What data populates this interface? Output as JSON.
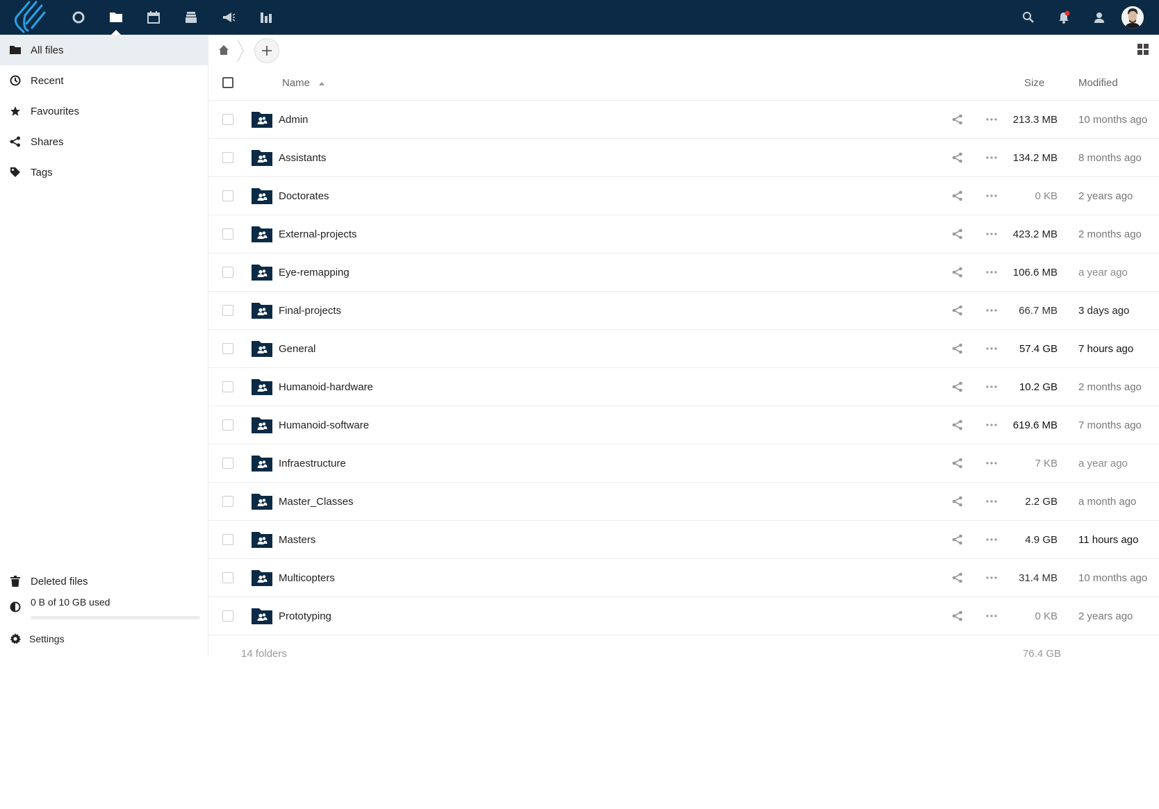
{
  "header": {
    "apps": [
      {
        "name": "dashboard",
        "icon": "circle-icon"
      },
      {
        "name": "files",
        "icon": "folder-icon",
        "active": true
      },
      {
        "name": "calendar",
        "icon": "calendar-icon"
      },
      {
        "name": "deck",
        "icon": "stack-icon"
      },
      {
        "name": "announcements",
        "icon": "megaphone-icon"
      },
      {
        "name": "analytics",
        "icon": "bar-chart-icon"
      }
    ],
    "right_icons": [
      "search-icon",
      "notifications-icon",
      "contacts-icon"
    ],
    "notification_dot_color": "#e9322d",
    "bg_color": "#0b2a45"
  },
  "sidebar": {
    "items": [
      {
        "label": "All files",
        "icon": "folder-icon",
        "active": true
      },
      {
        "label": "Recent",
        "icon": "clock-icon"
      },
      {
        "label": "Favourites",
        "icon": "star-icon"
      },
      {
        "label": "Shares",
        "icon": "share-icon"
      },
      {
        "label": "Tags",
        "icon": "tag-icon"
      }
    ],
    "deleted_files": "Deleted files",
    "quota": {
      "label": "0 B of 10 GB used",
      "fraction": 0.0
    },
    "settings": "Settings"
  },
  "table": {
    "columns": {
      "name": "Name",
      "size": "Size",
      "modified": "Modified"
    },
    "sort": {
      "column": "name",
      "direction": "ascending"
    },
    "rows": [
      {
        "name": "Admin",
        "size": "213.3 MB",
        "modified": "10 months ago",
        "size_color": "#222",
        "mod_color": "#777"
      },
      {
        "name": "Assistants",
        "size": "134.2 MB",
        "modified": "8 months ago",
        "size_color": "#222",
        "mod_color": "#777"
      },
      {
        "name": "Doctorates",
        "size": "0 KB",
        "modified": "2 years ago",
        "size_color": "#888",
        "mod_color": "#777"
      },
      {
        "name": "External-projects",
        "size": "423.2 MB",
        "modified": "2 months ago",
        "size_color": "#222",
        "mod_color": "#777"
      },
      {
        "name": "Eye-remapping",
        "size": "106.6 MB",
        "modified": "a year ago",
        "size_color": "#222",
        "mod_color": "#888"
      },
      {
        "name": "Final-projects",
        "size": "66.7 MB",
        "modified": "3 days ago",
        "size_color": "#333",
        "mod_color": "#222"
      },
      {
        "name": "General",
        "size": "57.4 GB",
        "modified": "7 hours ago",
        "size_color": "#111",
        "mod_color": "#111"
      },
      {
        "name": "Humanoid-hardware",
        "size": "10.2 GB",
        "modified": "2 months ago",
        "size_color": "#111",
        "mod_color": "#777"
      },
      {
        "name": "Humanoid-software",
        "size": "619.6 MB",
        "modified": "7 months ago",
        "size_color": "#111",
        "mod_color": "#777"
      },
      {
        "name": "Infraestructure",
        "size": "7 KB",
        "modified": "a year ago",
        "size_color": "#888",
        "mod_color": "#888"
      },
      {
        "name": "Master_Classes",
        "size": "2.2 GB",
        "modified": "a month ago",
        "size_color": "#222",
        "mod_color": "#777"
      },
      {
        "name": "Masters",
        "size": "4.9 GB",
        "modified": "11 hours ago",
        "size_color": "#222",
        "mod_color": "#111"
      },
      {
        "name": "Multicopters",
        "size": "31.4 MB",
        "modified": "10 months ago",
        "size_color": "#333",
        "mod_color": "#777"
      },
      {
        "name": "Prototyping",
        "size": "0 KB",
        "modified": "2 years ago",
        "size_color": "#888",
        "mod_color": "#777"
      }
    ],
    "summary": {
      "count": "14 folders",
      "total_size": "76.4 GB"
    }
  },
  "colors": {
    "folder": "#0b2a45",
    "accent": "#0082c9"
  }
}
